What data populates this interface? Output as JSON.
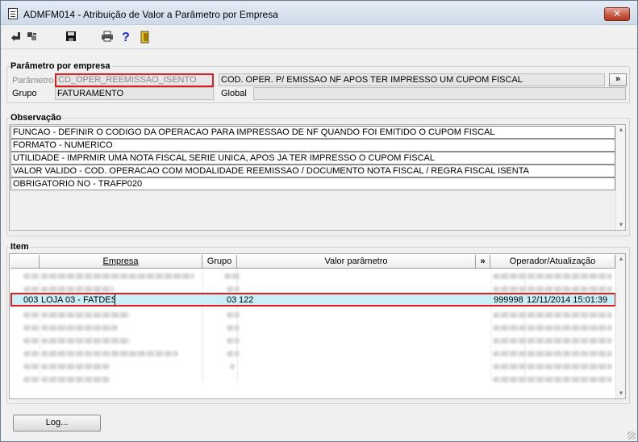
{
  "window": {
    "title": "ADMFM014 - Atribuição de Valor a Parâmetro por Empresa",
    "close_label": "✕"
  },
  "toolbar": {
    "icons": [
      "first-record-icon",
      "last-record-icon",
      "save-icon",
      "print-icon",
      "help-icon",
      "exit-icon"
    ]
  },
  "parametro_section": {
    "title": "Parâmetro por empresa",
    "parametro_label": "Parâmetro",
    "parametro_value": "CD_OPER_REEMISSAO_ISENTO",
    "parametro_desc": "COD. OPER. P/ EMISSAO NF APOS TER IMPRESSO UM CUPOM FISCAL",
    "lookup_label": "»",
    "grupo_label": "Grupo",
    "grupo_value": "FATURAMENTO",
    "global_label": "Global",
    "global_value": ""
  },
  "observacao": {
    "title": "Observação",
    "lines": [
      "FUNCAO - DEFINIR O CODIGO DA OPERACAO PARA IMPRESSAO DE NF QUANDO FOI EMITIDO O CUPOM FISCAL",
      "FORMATO - NUMERICO",
      "UTILIDADE - IMPRMIR UMA NOTA FISCAL SERIE UNICA, APOS JA TER IMPRESSO O CUPOM FISCAL",
      "VALOR VALIDO - COD. OPERACAO COM MODALIDADE REEMISSAO / DOCUMENTO NOTA FISCAL /  REGRA FISCAL ISENTA",
      "OBRIGATORIO NO - TRAFP020"
    ]
  },
  "item": {
    "title": "Item",
    "headers": {
      "empresa": "Empresa",
      "grupo": "Grupo",
      "valor": "Valor parâmetro",
      "expand": "»",
      "operador": "Operador/Atualização"
    },
    "selected": {
      "codigo": "003",
      "empresa": "LOJA 03 - FATDES",
      "grupo": "03",
      "valor": "122",
      "operador": "999998",
      "atualizacao": "12/11/2014 15:01:39"
    }
  },
  "buttons": {
    "log": "Log..."
  }
}
